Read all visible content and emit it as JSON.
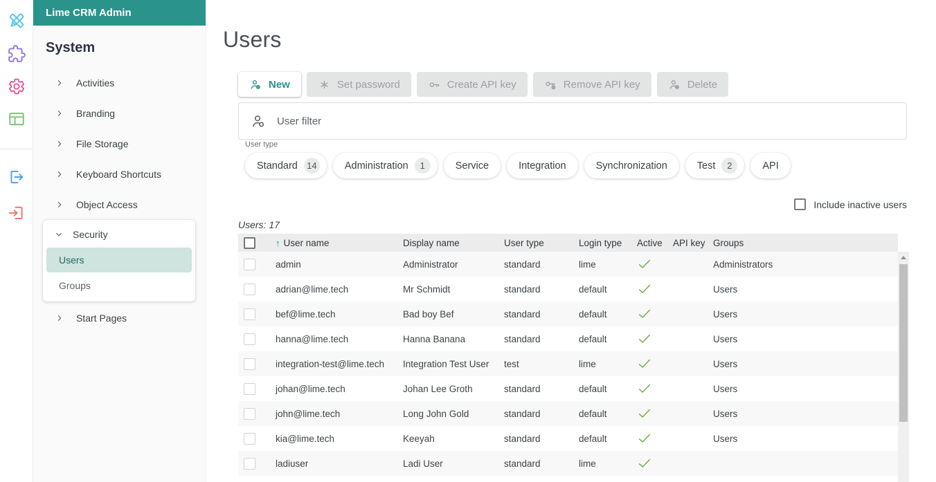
{
  "app_title": "Lime CRM Admin",
  "colors": {
    "teal": "#2a938a",
    "selected_item_bg": "#cfe3df",
    "selected_item_text": "#206b62",
    "active_check_green": "#6cb043",
    "rail_icon_colors": [
      "#56c8e8",
      "#9377d6",
      "#ea4796",
      "#7cc47c",
      "#4f9ef0",
      "#f0776b"
    ]
  },
  "sidebar": {
    "section_title": "System",
    "items": [
      {
        "label": "Activities",
        "expanded": false
      },
      {
        "label": "Branding",
        "expanded": false
      },
      {
        "label": "File Storage",
        "expanded": false
      },
      {
        "label": "Keyboard Shortcuts",
        "expanded": false
      },
      {
        "label": "Object Access",
        "expanded": false
      },
      {
        "label": "Security",
        "expanded": true,
        "children": [
          {
            "label": "Users",
            "selected": true
          },
          {
            "label": "Groups",
            "selected": false
          }
        ]
      },
      {
        "label": "Start Pages",
        "expanded": false
      }
    ]
  },
  "main": {
    "page_title": "Users",
    "toolbar": [
      {
        "label": "New",
        "enabled": true,
        "icon": "person-add-icon"
      },
      {
        "label": "Set password",
        "enabled": false,
        "icon": "password-asterisk-icon"
      },
      {
        "label": "Create API key",
        "enabled": false,
        "icon": "key-icon"
      },
      {
        "label": "Remove API key",
        "enabled": false,
        "icon": "key-remove-icon"
      },
      {
        "label": "Delete",
        "enabled": false,
        "icon": "person-remove-icon"
      }
    ],
    "filter_placeholder": "User filter",
    "user_type_label": "User type",
    "user_type_chips": [
      {
        "label": "Standard",
        "count": "14"
      },
      {
        "label": "Administration",
        "count": "1"
      },
      {
        "label": "Service",
        "count": null
      },
      {
        "label": "Integration",
        "count": null
      },
      {
        "label": "Synchronization",
        "count": null
      },
      {
        "label": "Test",
        "count": "2"
      },
      {
        "label": "API",
        "count": null
      }
    ],
    "include_inactive": {
      "label": "Include inactive users",
      "checked": false
    },
    "users_count": "Users: 17",
    "table": {
      "columns": [
        "User name",
        "Display name",
        "User type",
        "Login type",
        "Active",
        "API key",
        "Groups"
      ],
      "sorted_by": "User name",
      "sort_direction": "asc",
      "sort_arrow": "↑",
      "rows": [
        {
          "user_name": "admin",
          "display_name": "Administrator",
          "user_type": "standard",
          "login_type": "lime",
          "active": true,
          "api_key": "",
          "groups": "Administrators"
        },
        {
          "user_name": "adrian@lime.tech",
          "display_name": "Mr Schmidt",
          "user_type": "standard",
          "login_type": "default",
          "active": true,
          "api_key": "",
          "groups": "Users"
        },
        {
          "user_name": "bef@lime.tech",
          "display_name": "Bad boy Bef",
          "user_type": "standard",
          "login_type": "default",
          "active": true,
          "api_key": "",
          "groups": "Users"
        },
        {
          "user_name": "hanna@lime.tech",
          "display_name": "Hanna Banana",
          "user_type": "standard",
          "login_type": "default",
          "active": true,
          "api_key": "",
          "groups": "Users"
        },
        {
          "user_name": "integration-test@lime.tech",
          "display_name": "Integration Test User",
          "user_type": "test",
          "login_type": "lime",
          "active": true,
          "api_key": "",
          "groups": "Users"
        },
        {
          "user_name": "johan@lime.tech",
          "display_name": "Johan Lee Groth",
          "user_type": "standard",
          "login_type": "default",
          "active": true,
          "api_key": "",
          "groups": "Users"
        },
        {
          "user_name": "john@lime.tech",
          "display_name": "Long John Gold",
          "user_type": "standard",
          "login_type": "default",
          "active": true,
          "api_key": "",
          "groups": "Users"
        },
        {
          "user_name": "kia@lime.tech",
          "display_name": "Keeyah",
          "user_type": "standard",
          "login_type": "default",
          "active": true,
          "api_key": "",
          "groups": "Users"
        },
        {
          "user_name": "ladiuser",
          "display_name": "Ladi User",
          "user_type": "standard",
          "login_type": "lime",
          "active": true,
          "api_key": "",
          "groups": ""
        }
      ]
    }
  }
}
